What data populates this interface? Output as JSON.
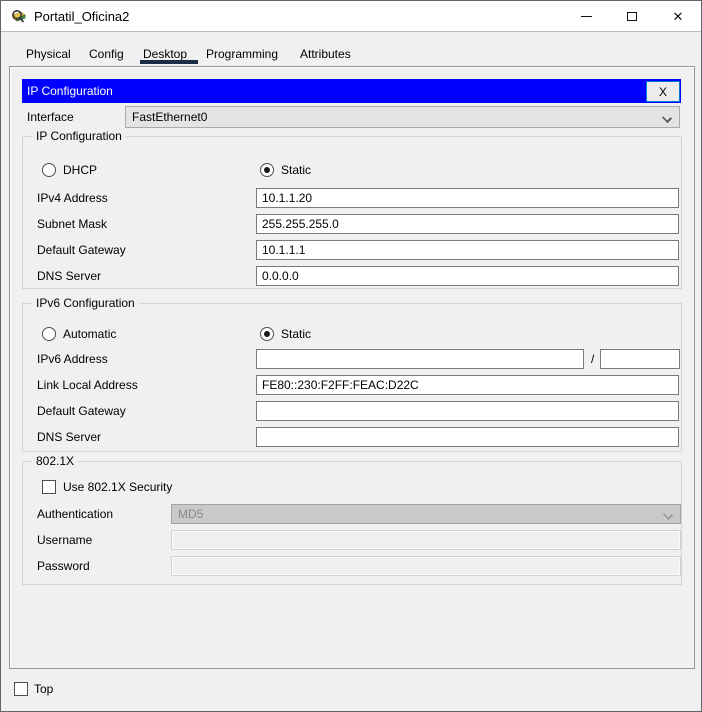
{
  "window": {
    "title": "Portatil_Oficina2",
    "controls": {
      "minimize": "minimize",
      "maximize": "maximize",
      "close": "✕"
    }
  },
  "tabs": [
    {
      "label": "Physical",
      "active": false
    },
    {
      "label": "Config",
      "active": false
    },
    {
      "label": "Desktop",
      "active": true
    },
    {
      "label": "Programming",
      "active": false
    },
    {
      "label": "Attributes",
      "active": false
    }
  ],
  "dialog": {
    "title": "IP Configuration",
    "close_label": "X",
    "interface_row": {
      "label": "Interface",
      "value": "FastEthernet0"
    },
    "ip": {
      "group_label": "IP Configuration",
      "dhcp_label": "DHCP",
      "static_label": "Static",
      "selected": "Static",
      "rows": [
        {
          "label": "IPv4 Address",
          "value": "10.1.1.20"
        },
        {
          "label": "Subnet Mask",
          "value": "255.255.255.0"
        },
        {
          "label": "Default Gateway",
          "value": "10.1.1.1"
        },
        {
          "label": "DNS Server",
          "value": "0.0.0.0"
        }
      ]
    },
    "ipv6": {
      "group_label": "IPv6 Configuration",
      "automatic_label": "Automatic",
      "static_label": "Static",
      "selected": "Static",
      "address_label": "IPv6 Address",
      "address_value": "",
      "prefix_separator": "/",
      "prefix_value": "",
      "rows": [
        {
          "label": "Link Local Address",
          "value": "FE80::230:F2FF:FEAC:D22C"
        },
        {
          "label": "Default Gateway",
          "value": ""
        },
        {
          "label": "DNS Server",
          "value": ""
        }
      ]
    },
    "dot1x": {
      "group_label": "802.1X",
      "checkbox_label": "Use 802.1X Security",
      "checked": false,
      "auth_label": "Authentication",
      "auth_value": "MD5",
      "username_label": "Username",
      "username_value": "",
      "password_label": "Password",
      "password_value": ""
    }
  },
  "footer": {
    "top_label": "Top",
    "checked": false
  },
  "colors": {
    "header_blue": "#0000ff",
    "tab_underline": "#1b2c47",
    "focus_border": "#0078d7"
  }
}
